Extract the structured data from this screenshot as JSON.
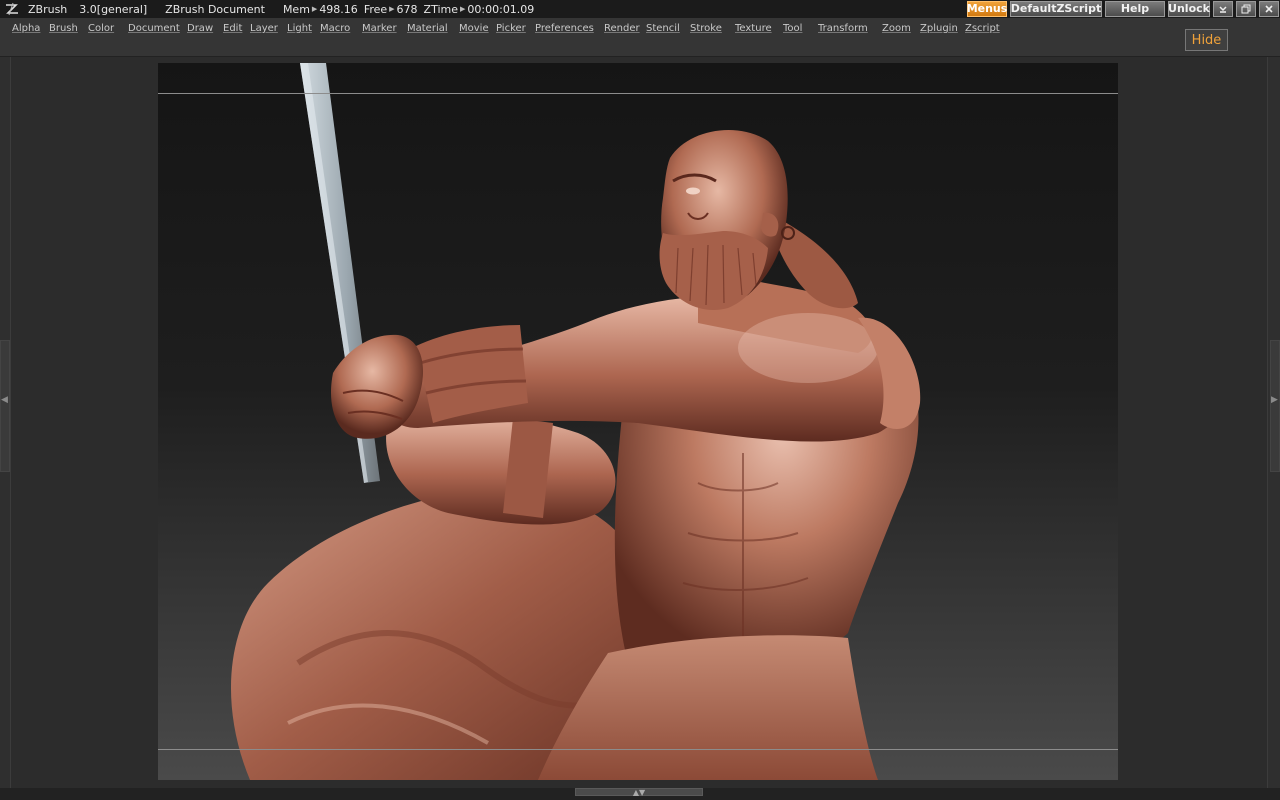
{
  "titlebar": {
    "app_name": "ZBrush",
    "version": "3.0[general]",
    "document": "ZBrush Document",
    "mem_label": "Mem",
    "mem_value": "498.16",
    "free_label": "Free",
    "free_value": "678",
    "ztime_label": "ZTime",
    "ztime_value": "00:00:01.09",
    "buttons": {
      "menus": "Menus",
      "default_zscript": "DefaultZScript",
      "help": "Help",
      "unlock": "Unlock"
    }
  },
  "menubar": {
    "items": [
      "Alpha",
      "Brush",
      "Color",
      "Document",
      "Draw",
      "Edit",
      "Layer",
      "Light",
      "Macro",
      "Marker",
      "Material",
      "Movie",
      "Picker",
      "Preferences",
      "Render",
      "Stencil",
      "Stroke",
      "Texture",
      "Tool",
      "Transform",
      "Zoom",
      "Zplugin",
      "Zscript"
    ],
    "hide_label": "Hide"
  },
  "colors": {
    "accent": "#f0a23a",
    "clay_light": "#e6b6a2",
    "clay_mid": "#b56d55",
    "clay_dark": "#5e2c20",
    "sword": "#b9c4cc",
    "canvas_top": "#151515",
    "canvas_bottom": "#4a4a4a"
  }
}
